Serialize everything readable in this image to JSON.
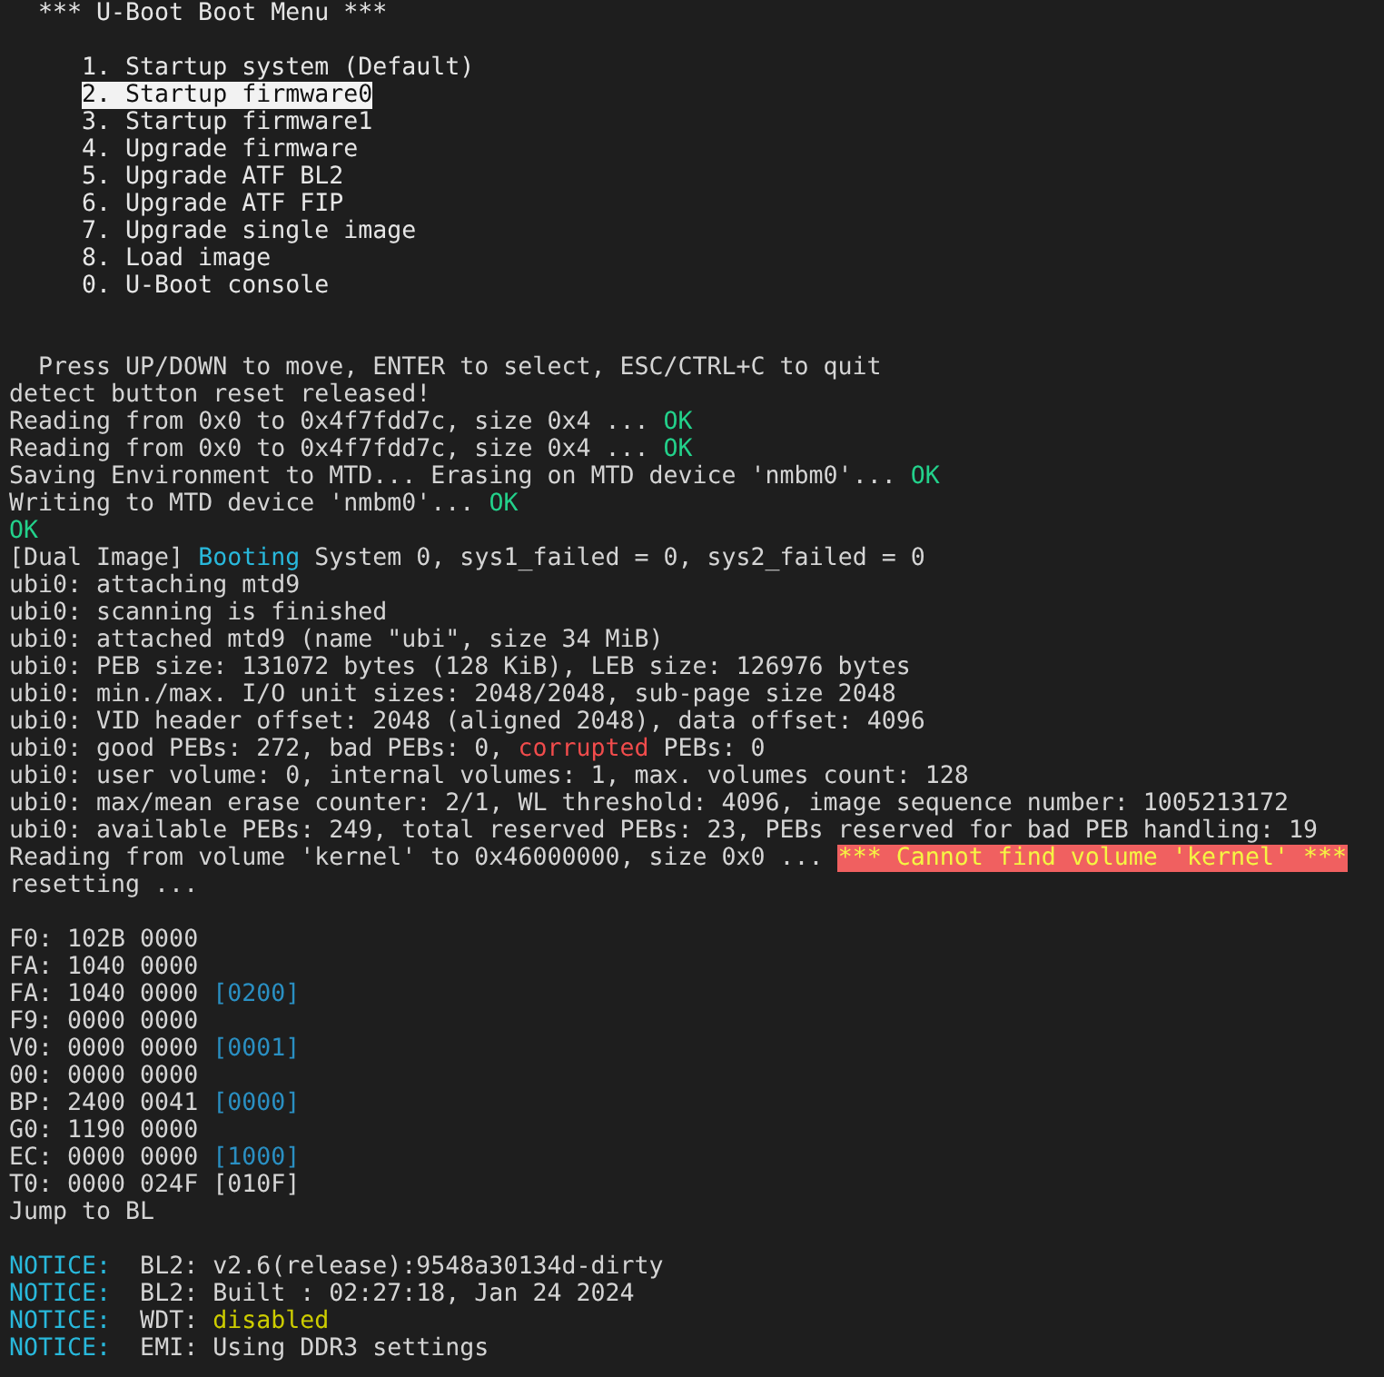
{
  "title": "*** U-Boot Boot Menu ***",
  "menu": {
    "items": [
      {
        "label": "1. Startup system (Default)",
        "selected": false
      },
      {
        "label": "2. Startup firmware0",
        "selected": true
      },
      {
        "label": "3. Startup firmware1",
        "selected": false
      },
      {
        "label": "4. Upgrade firmware",
        "selected": false
      },
      {
        "label": "5. Upgrade ATF BL2",
        "selected": false
      },
      {
        "label": "6. Upgrade ATF FIP",
        "selected": false
      },
      {
        "label": "7. Upgrade single image",
        "selected": false
      },
      {
        "label": "8. Load image",
        "selected": false
      },
      {
        "label": "0. U-Boot console",
        "selected": false
      }
    ]
  },
  "hint": "Press UP/DOWN to move, ENTER to select, ESC/CTRL+C to quit",
  "log_sections": [
    {
      "lines": [
        {
          "segments": [
            {
              "text": "detect button reset released!",
              "kind": "plain"
            }
          ]
        },
        {
          "segments": [
            {
              "text": "Reading from 0x0 to 0x4f7fdd7c, size 0x4 ... ",
              "kind": "plain"
            },
            {
              "text": "OK",
              "kind": "ok"
            }
          ]
        },
        {
          "segments": [
            {
              "text": "Reading from 0x0 to 0x4f7fdd7c, size 0x4 ... ",
              "kind": "plain"
            },
            {
              "text": "OK",
              "kind": "ok"
            }
          ]
        },
        {
          "segments": [
            {
              "text": "Saving Environment to MTD... Erasing on MTD device 'nmbm0'... ",
              "kind": "plain"
            },
            {
              "text": "OK",
              "kind": "ok"
            }
          ]
        },
        {
          "segments": [
            {
              "text": "Writing to MTD device 'nmbm0'... ",
              "kind": "plain"
            },
            {
              "text": "OK",
              "kind": "ok"
            }
          ]
        },
        {
          "segments": [
            {
              "text": "OK",
              "kind": "ok"
            }
          ]
        },
        {
          "segments": [
            {
              "text": "[Dual Image] ",
              "kind": "plain"
            },
            {
              "text": "Booting",
              "kind": "info"
            },
            {
              "text": " System 0, sys1_failed = 0, sys2_failed = 0",
              "kind": "plain"
            }
          ]
        },
        {
          "segments": [
            {
              "text": "ubi0: attaching mtd9",
              "kind": "plain"
            }
          ]
        },
        {
          "segments": [
            {
              "text": "ubi0: scanning is finished",
              "kind": "plain"
            }
          ]
        },
        {
          "segments": [
            {
              "text": "ubi0: attached mtd9 (name \"ubi\", size 34 MiB)",
              "kind": "plain"
            }
          ]
        },
        {
          "segments": [
            {
              "text": "ubi0: PEB size: 131072 bytes (128 KiB), LEB size: 126976 bytes",
              "kind": "plain"
            }
          ]
        },
        {
          "segments": [
            {
              "text": "ubi0: min./max. I/O unit sizes: 2048/2048, sub-page size 2048",
              "kind": "plain"
            }
          ]
        },
        {
          "segments": [
            {
              "text": "ubi0: VID header offset: 2048 (aligned 2048), data offset: 4096",
              "kind": "plain"
            }
          ]
        },
        {
          "segments": [
            {
              "text": "ubi0: good PEBs: 272, bad PEBs: 0, ",
              "kind": "plain"
            },
            {
              "text": "corrupted",
              "kind": "error"
            },
            {
              "text": " PEBs: 0",
              "kind": "plain"
            }
          ]
        },
        {
          "segments": [
            {
              "text": "ubi0: user volume: 0, internal volumes: 1, max. volumes count: 128",
              "kind": "plain"
            }
          ]
        },
        {
          "segments": [
            {
              "text": "ubi0: max/mean erase counter: 2/1, WL threshold: 4096, image sequence number: 1005213172",
              "kind": "plain"
            }
          ]
        },
        {
          "segments": [
            {
              "text": "ubi0: available PEBs: 249, total reserved PEBs: 23, PEBs reserved for bad PEB handling: 19",
              "kind": "plain"
            }
          ]
        },
        {
          "segments": [
            {
              "text": "Reading from volume 'kernel' to 0x46000000, size 0x0 ... ",
              "kind": "plain"
            },
            {
              "text": "*** Cannot find volume 'kernel' ***",
              "kind": "alert"
            }
          ]
        },
        {
          "segments": [
            {
              "text": "resetting ...",
              "kind": "plain"
            }
          ]
        }
      ]
    },
    {
      "lines": [
        {
          "segments": [
            {
              "text": "F0: 102B 0000",
              "kind": "plain"
            }
          ]
        },
        {
          "segments": [
            {
              "text": "FA: 1040 0000",
              "kind": "plain"
            }
          ]
        },
        {
          "segments": [
            {
              "text": "FA: 1040 0000 ",
              "kind": "plain"
            },
            {
              "text": "[0200]",
              "kind": "code"
            }
          ]
        },
        {
          "segments": [
            {
              "text": "F9: 0000 0000",
              "kind": "plain"
            }
          ]
        },
        {
          "segments": [
            {
              "text": "V0: 0000 0000 ",
              "kind": "plain"
            },
            {
              "text": "[0001]",
              "kind": "code"
            }
          ]
        },
        {
          "segments": [
            {
              "text": "00: 0000 0000",
              "kind": "plain"
            }
          ]
        },
        {
          "segments": [
            {
              "text": "BP: 2400 0041 ",
              "kind": "plain"
            },
            {
              "text": "[0000]",
              "kind": "code"
            }
          ]
        },
        {
          "segments": [
            {
              "text": "G0: 1190 0000",
              "kind": "plain"
            }
          ]
        },
        {
          "segments": [
            {
              "text": "EC: 0000 0000 ",
              "kind": "plain"
            },
            {
              "text": "[1000]",
              "kind": "code"
            }
          ]
        },
        {
          "segments": [
            {
              "text": "T0: 0000 024F [010F]",
              "kind": "plain"
            }
          ]
        },
        {
          "segments": [
            {
              "text": "Jump to BL",
              "kind": "plain"
            }
          ]
        }
      ]
    },
    {
      "lines": [
        {
          "segments": [
            {
              "text": "NOTICE:",
              "kind": "notice"
            },
            {
              "text": "  BL2: v2.6(release):9548a30134d-dirty",
              "kind": "plain"
            }
          ]
        },
        {
          "segments": [
            {
              "text": "NOTICE:",
              "kind": "notice"
            },
            {
              "text": "  BL2: Built : 02:27:18, Jan 24 2024",
              "kind": "plain"
            }
          ]
        },
        {
          "segments": [
            {
              "text": "NOTICE:",
              "kind": "notice"
            },
            {
              "text": "  WDT: ",
              "kind": "plain"
            },
            {
              "text": "disabled",
              "kind": "warn"
            }
          ]
        },
        {
          "segments": [
            {
              "text": "NOTICE:",
              "kind": "notice"
            },
            {
              "text": "  EMI: Using DDR3 settings",
              "kind": "plain"
            }
          ]
        }
      ]
    }
  ]
}
